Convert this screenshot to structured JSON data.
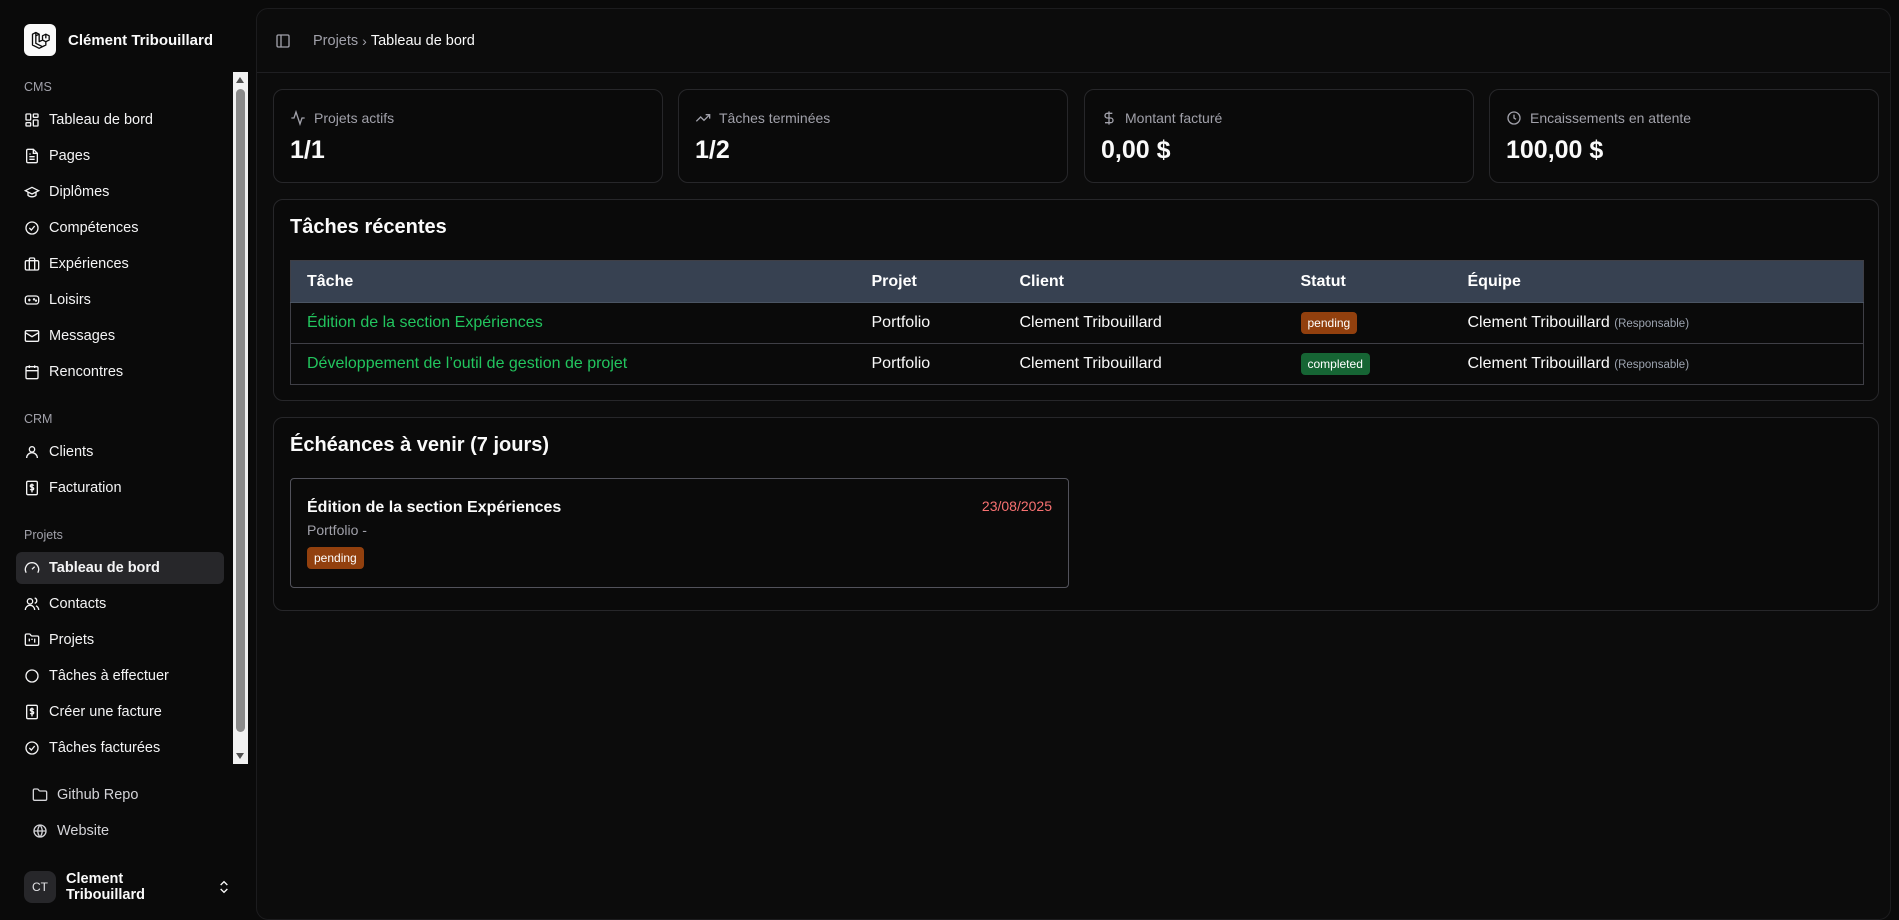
{
  "sidebar": {
    "brand_name": "Clément Tribouillard",
    "groups": [
      {
        "label": "CMS",
        "items": [
          {
            "label": "Tableau de bord",
            "icon": "layout-grid-icon"
          },
          {
            "label": "Pages",
            "icon": "file-text-icon"
          },
          {
            "label": "Diplômes",
            "icon": "graduation-cap-icon"
          },
          {
            "label": "Compétences",
            "icon": "circle-check-icon"
          },
          {
            "label": "Expériences",
            "icon": "briefcase-icon"
          },
          {
            "label": "Loisirs",
            "icon": "gamepad-icon"
          },
          {
            "label": "Messages",
            "icon": "mail-icon"
          },
          {
            "label": "Rencontres",
            "icon": "calendar-icon"
          }
        ]
      },
      {
        "label": "CRM",
        "items": [
          {
            "label": "Clients",
            "icon": "user-icon"
          },
          {
            "label": "Facturation",
            "icon": "receipt-dollar-icon"
          }
        ]
      },
      {
        "label": "Projets",
        "items": [
          {
            "label": "Tableau de bord",
            "icon": "gauge-icon",
            "active": true
          },
          {
            "label": "Contacts",
            "icon": "users-icon"
          },
          {
            "label": "Projets",
            "icon": "folder-kanban-icon"
          },
          {
            "label": "Tâches à effectuer",
            "icon": "circle-icon"
          },
          {
            "label": "Créer une facture",
            "icon": "receipt-dollar-icon"
          },
          {
            "label": "Tâches facturées",
            "icon": "circle-check-icon"
          }
        ]
      }
    ],
    "links": [
      {
        "label": "Github Repo",
        "icon": "folder-icon"
      },
      {
        "label": "Website",
        "icon": "globe-icon"
      }
    ],
    "user": {
      "initials": "CT",
      "name": "Clement Tribouillard"
    }
  },
  "breadcrumb": {
    "parent": "Projets",
    "current": "Tableau de bord"
  },
  "stats": [
    {
      "label": "Projets actifs",
      "value": "1/1",
      "icon": "activity-icon"
    },
    {
      "label": "Tâches terminées",
      "value": "1/2",
      "icon": "trending-up-icon"
    },
    {
      "label": "Montant facturé",
      "value": "0,00 $",
      "icon": "dollar-icon"
    },
    {
      "label": "Encaissements en attente",
      "value": "100,00 $",
      "icon": "clock-icon"
    }
  ],
  "recent_tasks": {
    "title": "Tâches récentes",
    "columns": [
      "Tâche",
      "Projet",
      "Client",
      "Statut",
      "Équipe"
    ],
    "rows": [
      {
        "task": "Édition de la section Expériences",
        "project": "Portfolio",
        "client": "Clement Tribouillard",
        "status": "pending",
        "team": "Clement Tribouillard",
        "role": "(Responsable)"
      },
      {
        "task": "Développement de l’outil de gestion de projet",
        "project": "Portfolio",
        "client": "Clement Tribouillard",
        "status": "completed",
        "team": "Clement Tribouillard",
        "role": "(Responsable)"
      }
    ]
  },
  "deadlines": {
    "title": "Échéances à venir (7 jours)",
    "items": [
      {
        "title": "Édition de la section Expériences",
        "subtitle": "Portfolio -",
        "date": "23/08/2025",
        "status": "pending"
      }
    ]
  },
  "colors": {
    "task_link": "#22c55e",
    "pending": "#92400e",
    "completed": "#166534",
    "due_date": "#f87171",
    "table_header": "#374151"
  }
}
